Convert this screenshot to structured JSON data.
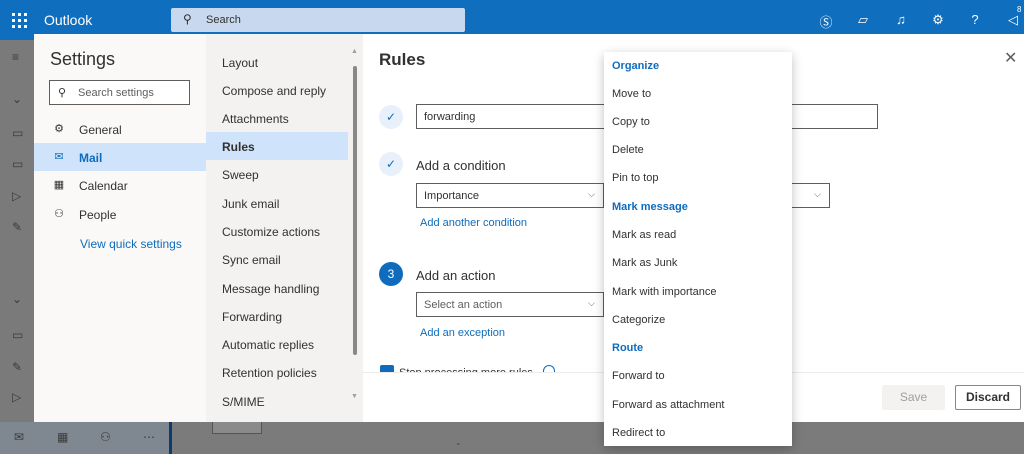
{
  "topbar": {
    "app_title": "Outlook",
    "search_placeholder": "Search",
    "icons": [
      "skype-icon",
      "feedback-icon",
      "bell-icon",
      "gear-icon",
      "help-icon",
      "megaphone-icon"
    ],
    "notification_count": "8"
  },
  "settings": {
    "title": "Settings",
    "search_placeholder": "Search settings",
    "categories": [
      {
        "label": "General",
        "icon": "gear-icon"
      },
      {
        "label": "Mail",
        "icon": "mail-icon"
      },
      {
        "label": "Calendar",
        "icon": "calendar-icon"
      },
      {
        "label": "People",
        "icon": "people-icon"
      }
    ],
    "active_category": "Mail",
    "quick_settings_link": "View quick settings"
  },
  "mail_subsections": [
    "Layout",
    "Compose and reply",
    "Attachments",
    "Rules",
    "Sweep",
    "Junk email",
    "Customize actions",
    "Sync email",
    "Message handling",
    "Forwarding",
    "Automatic replies",
    "Retention policies",
    "S/MIME"
  ],
  "active_subsection": "Rules",
  "rules": {
    "title": "Rules",
    "name_value": "forwarding",
    "condition_label": "Add a condition",
    "condition_value": "Importance",
    "add_condition_link": "Add another condition",
    "action_step_number": "3",
    "action_label": "Add an action",
    "action_placeholder": "Select an action",
    "add_exception_link": "Add an exception",
    "stop_processing_text": "Stop processing more rules",
    "save_label": "Save",
    "discard_label": "Discard"
  },
  "action_menu": {
    "groups": [
      {
        "header": "Organize",
        "items": [
          "Move to",
          "Copy to",
          "Delete",
          "Pin to top"
        ]
      },
      {
        "header": "Mark message",
        "items": [
          "Mark as read",
          "Mark as Junk",
          "Mark with importance",
          "Categorize"
        ]
      },
      {
        "header": "Route",
        "items": [
          "Forward to",
          "Forward as attachment",
          "Redirect to"
        ]
      }
    ]
  },
  "colors": {
    "brand": "#106ebe",
    "accent": "#0f6cbd",
    "selected_bg": "#cfe4fa"
  }
}
